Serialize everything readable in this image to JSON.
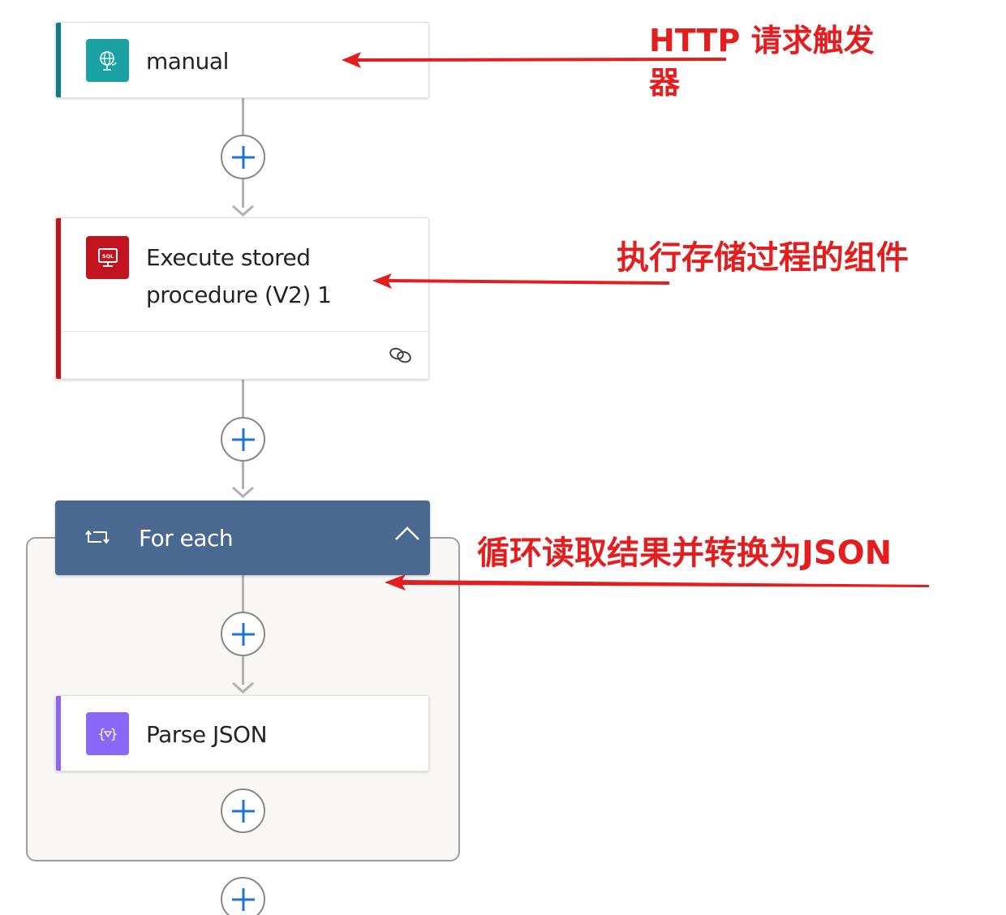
{
  "flow": {
    "trigger": {
      "title": "manual",
      "icon": "http-globe-icon",
      "accent": "#0e7c86"
    },
    "actions": [
      {
        "title": "Execute stored procedure (V2) 1",
        "title_line1": "Execute stored",
        "title_line2": "procedure (V2) 1",
        "icon": "sql-monitor-icon",
        "accent": "#c1141e",
        "footer_icon": "link-icon"
      },
      {
        "title": "For each",
        "icon": "loop-icon",
        "accent": "#4a6890",
        "expanded": true
      }
    ],
    "foreach_children": [
      {
        "title": "Parse JSON",
        "icon": "braces-filter-icon",
        "accent": "#8a67f5"
      }
    ],
    "add_step_label": "+"
  },
  "annotations": {
    "trigger": {
      "line1": "HTTP 请求触发",
      "line2": "器"
    },
    "stored_procedure": {
      "text": "执行存储过程的组件"
    },
    "foreach": {
      "text": "循环读取结果并转换为JSON"
    },
    "color": "#e41e1e"
  }
}
